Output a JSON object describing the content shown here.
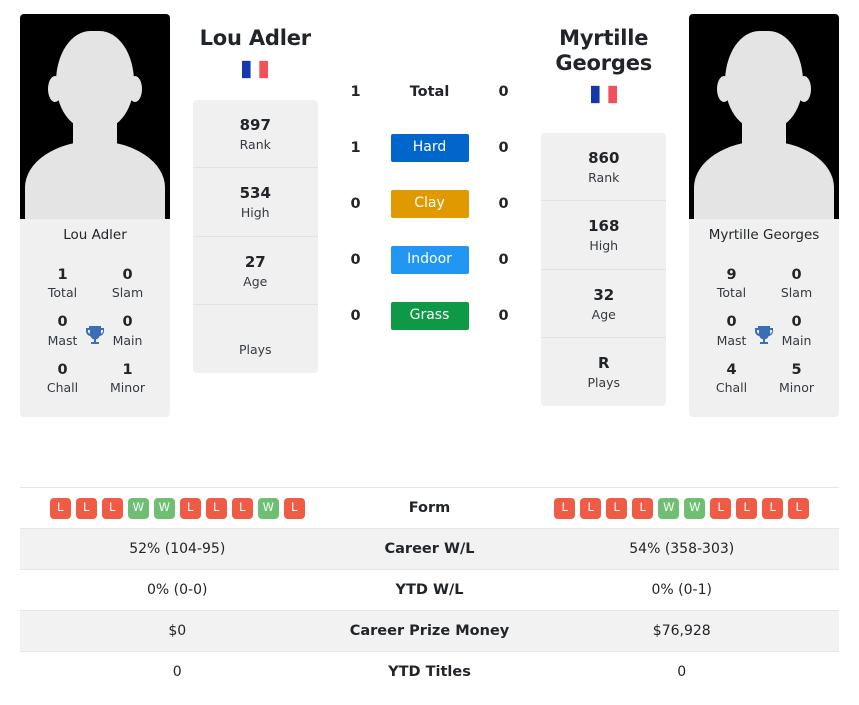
{
  "left_player": {
    "name": "Lou Adler",
    "photo_caption": "Lou Adler",
    "flag": "fr",
    "flag_name": "france-flag",
    "info": [
      {
        "value": "897",
        "label": "Rank"
      },
      {
        "value": "534",
        "label": "High"
      },
      {
        "value": "27",
        "label": "Age"
      },
      {
        "value": "",
        "label": "Plays"
      }
    ],
    "titles": [
      {
        "value": "1",
        "label": "Total"
      },
      {
        "value": "0",
        "label": "Slam"
      },
      {
        "value": "0",
        "label": "Mast"
      },
      {
        "value": "0",
        "label": "Main"
      },
      {
        "value": "0",
        "label": "Chall"
      },
      {
        "value": "1",
        "label": "Minor"
      }
    ],
    "form": [
      "L",
      "L",
      "L",
      "W",
      "W",
      "L",
      "L",
      "L",
      "W",
      "L"
    ],
    "career_wl": "52% (104-95)",
    "ytd_wl": "0% (0-0)",
    "career_prize_money": "$0",
    "ytd_titles": "0"
  },
  "right_player": {
    "name": "Myrtille Georges",
    "photo_caption": "Myrtille Georges",
    "flag": "fr",
    "flag_name": "france-flag",
    "info": [
      {
        "value": "860",
        "label": "Rank"
      },
      {
        "value": "168",
        "label": "High"
      },
      {
        "value": "32",
        "label": "Age"
      },
      {
        "value": "R",
        "label": "Plays"
      }
    ],
    "titles": [
      {
        "value": "9",
        "label": "Total"
      },
      {
        "value": "0",
        "label": "Slam"
      },
      {
        "value": "0",
        "label": "Mast"
      },
      {
        "value": "0",
        "label": "Main"
      },
      {
        "value": "4",
        "label": "Chall"
      },
      {
        "value": "5",
        "label": "Minor"
      }
    ],
    "form": [
      "L",
      "L",
      "L",
      "L",
      "W",
      "W",
      "L",
      "L",
      "L",
      "L"
    ],
    "career_wl": "54% (358-303)",
    "ytd_wl": "0% (0-1)",
    "career_prize_money": "$76,928",
    "ytd_titles": "0"
  },
  "surfaces": [
    {
      "label": "Total",
      "left": "1",
      "right": "0",
      "badge": false,
      "color": ""
    },
    {
      "label": "Hard",
      "left": "1",
      "right": "0",
      "badge": true,
      "color": "#0066cc"
    },
    {
      "label": "Clay",
      "left": "0",
      "right": "0",
      "badge": true,
      "color": "#e09900"
    },
    {
      "label": "Indoor",
      "left": "0",
      "right": "0",
      "badge": true,
      "color": "#2196f3"
    },
    {
      "label": "Grass",
      "left": "0",
      "right": "0",
      "badge": true,
      "color": "#0e9946"
    }
  ],
  "table_rows": [
    {
      "label": "Form"
    },
    {
      "label": "Career W/L"
    },
    {
      "label": "YTD W/L"
    },
    {
      "label": "Career Prize Money"
    },
    {
      "label": "YTD Titles"
    }
  ],
  "icons": {
    "trophy": "🏆",
    "trophy_name": "trophy-icon"
  },
  "colors": {
    "win": "#6fbf73",
    "loss": "#ef5b45",
    "hard": "#0066cc",
    "clay": "#e09900",
    "indoor": "#2196f3",
    "grass": "#0e9946",
    "card_bg": "#f0f0f0",
    "row_shade": "#f2f2f2"
  }
}
